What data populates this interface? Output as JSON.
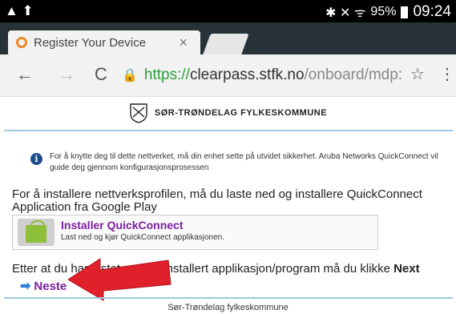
{
  "statusbar": {
    "left_icons": "▲ ⬆",
    "signal": "✱ ✕ ᯤ",
    "battery": "95%",
    "time": "09:24"
  },
  "tab": {
    "title": "Register Your Device",
    "close": "×"
  },
  "url": {
    "scheme": "https://",
    "host": "clearpass.stfk.no",
    "path": "/onboard/mdp:"
  },
  "header": {
    "org": "SØR-TRØNDELAG FYLKESKOMMUNE"
  },
  "info": {
    "text": "For å knytte deg til dette nettverket, må din enhet sette på utvidet sikkerhet. Aruba Networks QuickConnect vil guide deg gjennom konfigurasjonsprosessen"
  },
  "install": {
    "intro": "For å installere nettverksprofilen, må du laste ned og installere QuickConnect Application fra Google Play",
    "link": "Installer QuickConnect",
    "sub": "Last ned og kjør QuickConnect applikasjonen."
  },
  "after": {
    "text": "Etter at du har lastet ned og installert applikasjon/program må du klikke ",
    "bold": "Next"
  },
  "neste": {
    "label": "Neste"
  },
  "footer": {
    "text": "Sør-Trøndelag fylkeskommune"
  },
  "colors": {
    "accent_link": "#7a1fa0",
    "url_green": "#2e9e3e",
    "tabstrip": "#263238",
    "arrow_red": "#e0202a"
  }
}
